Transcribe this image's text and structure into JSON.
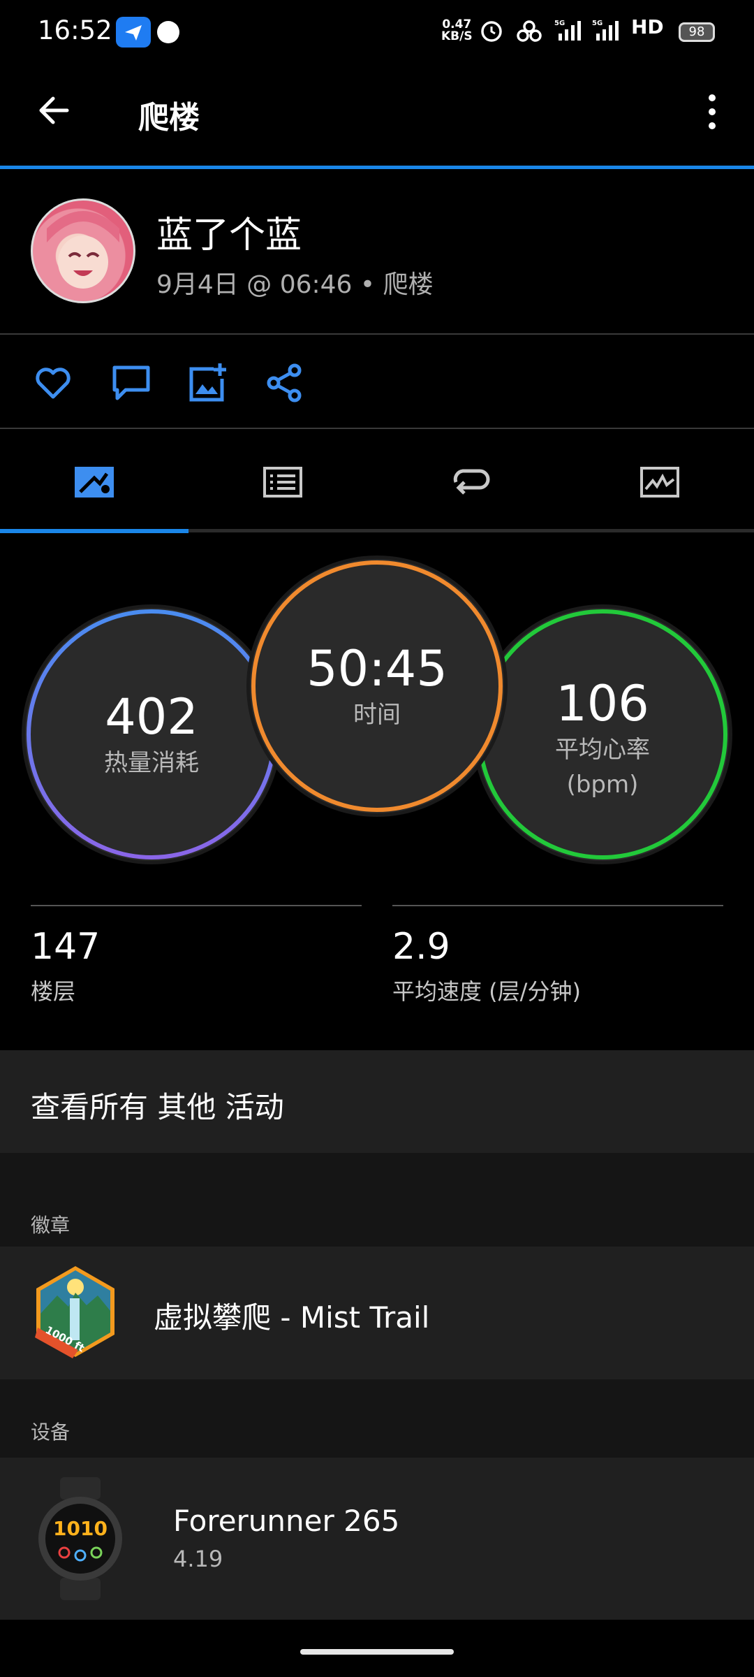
{
  "status_bar": {
    "time": "16:52",
    "net_speed_value": "0.47",
    "net_speed_unit": "KB/S",
    "network_5g_1": "5G",
    "network_5g_2": "5G",
    "hd_label": "HD",
    "battery": "98"
  },
  "app_bar": {
    "title": "爬楼",
    "back_icon": "arrow-left-icon",
    "menu_icon": "more-vertical-icon"
  },
  "profile": {
    "user_name": "蓝了个蓝",
    "meta": "9月4日 @ 06:46 • 爬楼"
  },
  "actions": [
    "heart-icon",
    "comment-icon",
    "add-photo-icon",
    "share-icon"
  ],
  "tabs": [
    "overview-icon",
    "list-icon",
    "laps-icon",
    "chart-icon"
  ],
  "rings": {
    "calories": {
      "value": "402",
      "label": "热量消耗",
      "color": "#4a8cf0"
    },
    "time": {
      "value": "50:45",
      "label": "时间",
      "color": "#f08a2e"
    },
    "heart_rate": {
      "value": "106",
      "label": "平均心率",
      "unit": "(bpm)",
      "color": "#22c93a"
    }
  },
  "stats": {
    "floors": {
      "value": "147",
      "label": "楼层"
    },
    "speed": {
      "value": "2.9",
      "label": "平均速度 (层/分钟)"
    }
  },
  "view_all": "查看所有 其他 活动",
  "badges": {
    "section_label": "徽章",
    "badge_name": "虚拟攀爬 - Mist Trail",
    "badge_tag": "1000 ft"
  },
  "devices": {
    "section_label": "设备",
    "device_name": "Forerunner 265",
    "device_version": "4.19",
    "watch_time": "1010"
  }
}
